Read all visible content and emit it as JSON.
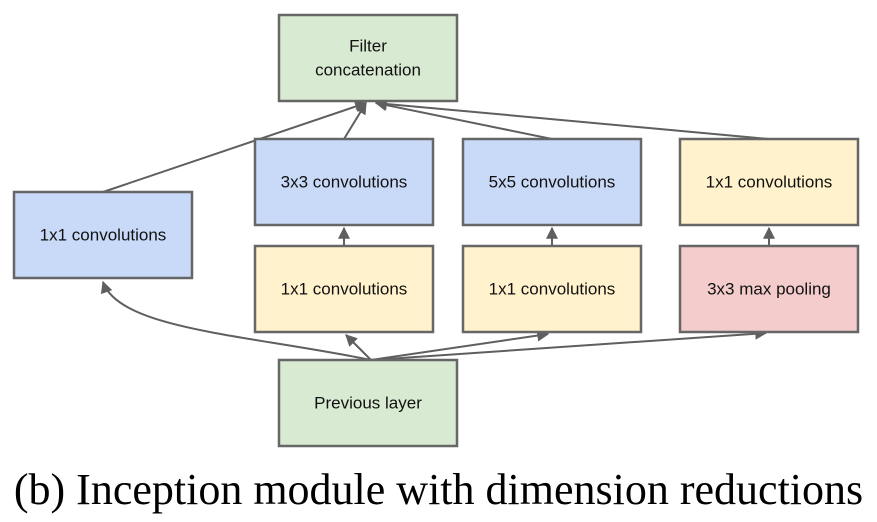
{
  "colors": {
    "green": "#d9ead3",
    "blue": "#c9daf8",
    "yellow": "#fff2cc",
    "red": "#f4cccc",
    "red_border": "#e06666",
    "border": "#666666",
    "edge": "#5f5f5f"
  },
  "nodes": {
    "concat": {
      "lines": [
        "Filter",
        "concatenation"
      ],
      "color": "green"
    },
    "conv1x1_direct": {
      "label": "1x1 convolutions",
      "color": "blue"
    },
    "conv3x3": {
      "label": "3x3 convolutions",
      "color": "blue"
    },
    "conv5x5": {
      "label": "5x5 convolutions",
      "color": "blue"
    },
    "conv1x1_pool_proj": {
      "label": "1x1 convolutions",
      "color": "yellow"
    },
    "reduce_3x3": {
      "label": "1x1 convolutions",
      "color": "yellow"
    },
    "reduce_5x5": {
      "label": "1x1 convolutions",
      "color": "yellow"
    },
    "maxpool": {
      "label": "3x3 max pooling",
      "color": "red"
    },
    "previous": {
      "label": "Previous layer",
      "color": "green"
    }
  },
  "edges": [
    {
      "from": "previous",
      "to": "conv1x1_direct"
    },
    {
      "from": "previous",
      "to": "reduce_3x3"
    },
    {
      "from": "previous",
      "to": "reduce_5x5"
    },
    {
      "from": "previous",
      "to": "maxpool"
    },
    {
      "from": "reduce_3x3",
      "to": "conv3x3"
    },
    {
      "from": "reduce_5x5",
      "to": "conv5x5"
    },
    {
      "from": "maxpool",
      "to": "conv1x1_pool_proj"
    },
    {
      "from": "conv1x1_direct",
      "to": "concat"
    },
    {
      "from": "conv3x3",
      "to": "concat"
    },
    {
      "from": "conv5x5",
      "to": "concat"
    },
    {
      "from": "conv1x1_pool_proj",
      "to": "concat"
    }
  ],
  "caption": "(b)  Inception module with dimension reductions"
}
